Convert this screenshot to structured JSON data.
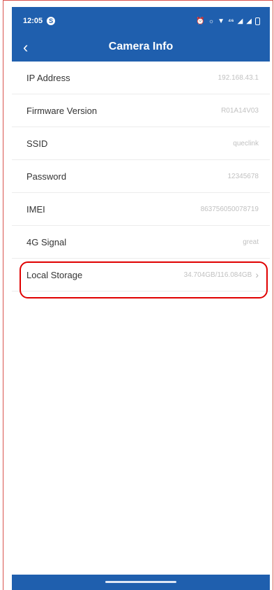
{
  "status_bar": {
    "time": "12:05",
    "app_badge": "S"
  },
  "header": {
    "title": "Camera Info",
    "back_glyph": "‹"
  },
  "info_rows": [
    {
      "label": "IP Address",
      "value": "192.168.43.1"
    },
    {
      "label": "Firmware Version",
      "value": "R01A14V03"
    },
    {
      "label": "SSID",
      "value": "queclink"
    },
    {
      "label": "Password",
      "value": "12345678"
    },
    {
      "label": "IMEI",
      "value": "863756050078719"
    },
    {
      "label": "4G Signal",
      "value": "great"
    },
    {
      "label": "Local Storage",
      "value": "34.704GB/116.084GB",
      "chevron": "›"
    }
  ],
  "colors": {
    "header_bg": "#1f5fae",
    "highlight": "#e00000"
  }
}
